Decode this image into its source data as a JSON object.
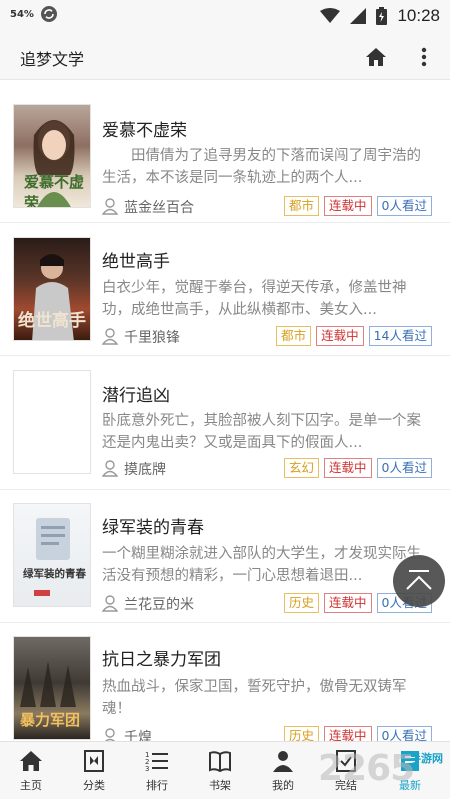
{
  "statusbar": {
    "battery_saver": "54%",
    "time": "10:28"
  },
  "appbar": {
    "title": "追梦文学"
  },
  "books": [
    {
      "title": "爱慕不虚荣",
      "desc": "田倩倩为了追寻男友的下落而误闯了周宇浩的生活，本不该是同一条轨迹上的两个人...",
      "author": "蓝金丝百合",
      "genre": "都市",
      "status": "连载中",
      "views": "0人看过",
      "cover_text": "爱慕不虚荣"
    },
    {
      "title": "绝世高手",
      "desc": "白衣少年，觉醒于拳台，得逆天传承，修盖世神功，成绝世高手，从此纵横都市、美女入...",
      "author": "千里狼锋",
      "genre": "都市",
      "status": "连载中",
      "views": "14人看过",
      "cover_text": "绝世高手"
    },
    {
      "title": "潜行追凶",
      "desc": "卧底意外死亡，其脸部被人刻下囚字。是单一个案还是内鬼出卖？又或是面具下的假面人...",
      "author": "摸底牌",
      "genre": "玄幻",
      "status": "连载中",
      "views": "0人看过",
      "cover_text": ""
    },
    {
      "title": "绿军装的青春",
      "desc": "一个糊里糊涂就进入部队的大学生，才发现实际生活没有预想的精彩，一门心思想着退田...",
      "author": "兰花豆的米",
      "genre": "历史",
      "status": "连载中",
      "views": "0人看过",
      "cover_text": "绿军装的青春"
    },
    {
      "title": "抗日之暴力军团",
      "desc": "热血战斗，保家卫国，誓死守护，傲骨无双铸军魂！",
      "author": "千煌",
      "genre": "历史",
      "status": "连载中",
      "views": "0人看过",
      "cover_text": "暴力军团"
    }
  ],
  "bottomnav": {
    "items": [
      {
        "label": "主页",
        "icon": "home-icon"
      },
      {
        "label": "分类",
        "icon": "category-icon"
      },
      {
        "label": "排行",
        "icon": "ranking-icon"
      },
      {
        "label": "书架",
        "icon": "bookshelf-icon"
      },
      {
        "label": "我的",
        "icon": "profile-icon"
      },
      {
        "label": "完结",
        "icon": "finished-icon"
      },
      {
        "label": "最新",
        "icon": "latest-icon"
      }
    ]
  },
  "watermark": {
    "logo": "2265",
    "sub": "手游网"
  },
  "colors": {
    "accent": "#1aa3c8",
    "genre": "#d8a020",
    "status": "#d03030",
    "views": "#3a6fb8"
  }
}
